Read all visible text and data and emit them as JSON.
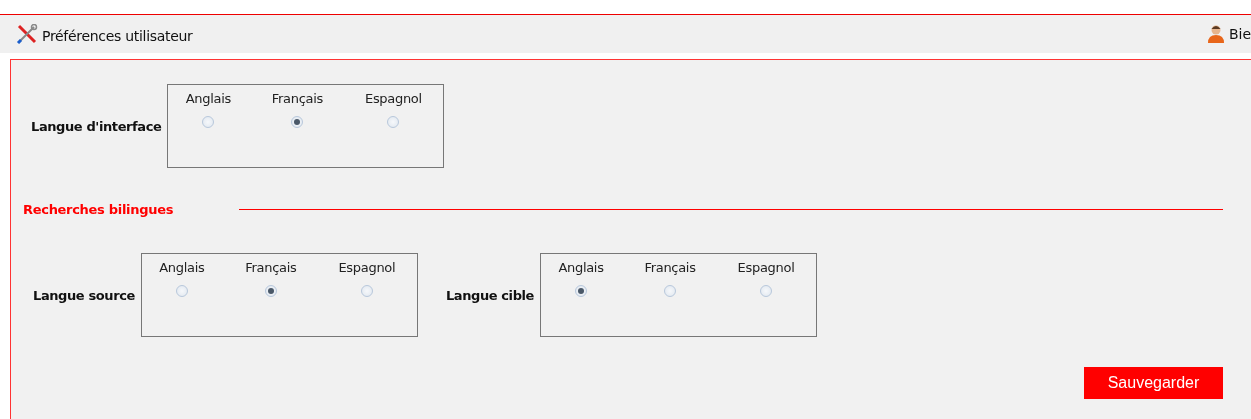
{
  "header": {
    "title": "Préférences utilisateur",
    "user_text": "Bie"
  },
  "interface_language": {
    "label": "Langue d'interface",
    "options": [
      {
        "label": "Anglais",
        "selected": false
      },
      {
        "label": "Français",
        "selected": true
      },
      {
        "label": "Espagnol",
        "selected": false
      }
    ]
  },
  "bilingual_section": {
    "title": "Recherches bilingues",
    "groups": [
      {
        "label": "Langue source",
        "options": [
          {
            "label": "Anglais",
            "selected": false
          },
          {
            "label": "Français",
            "selected": true
          },
          {
            "label": "Espagnol",
            "selected": false
          }
        ]
      },
      {
        "label": "Langue cible",
        "options": [
          {
            "label": "Anglais",
            "selected": true
          },
          {
            "label": "Français",
            "selected": false
          },
          {
            "label": "Espagnol",
            "selected": false
          }
        ]
      }
    ]
  },
  "save_button": "Sauvegarder"
}
